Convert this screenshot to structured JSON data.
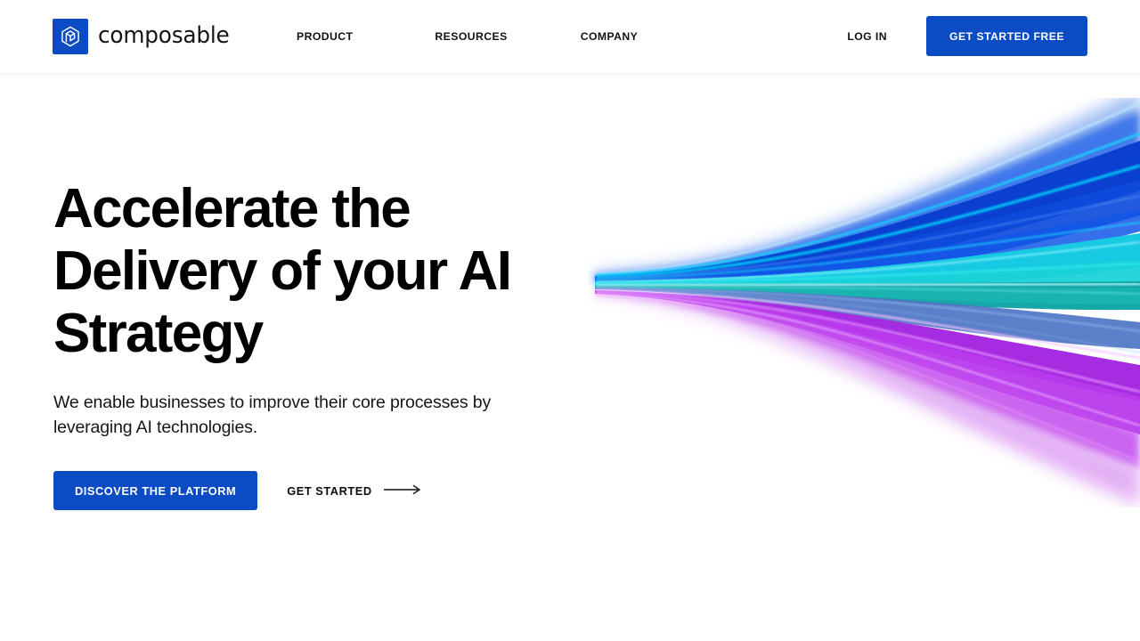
{
  "site": {
    "brand_name": "composable",
    "accent_color": "#0B4BC4",
    "text_color": "#000000",
    "background_color": "#FFFFFF"
  },
  "header": {
    "logo": {
      "icon": "hexagon-cube-icon",
      "wordmark": "composable"
    },
    "nav": [
      {
        "label": "PRODUCT"
      },
      {
        "label": "RESOURCES"
      },
      {
        "label": "COMPANY"
      }
    ],
    "login_label": "LOG IN",
    "cta_label": "GET STARTED FREE"
  },
  "hero": {
    "title_line_1": "Accelerate the",
    "title_line_2": "Delivery of your AI",
    "title_line_3": "Strategy",
    "title": "Accelerate the Delivery of your AI Strategy",
    "subtitle": "We enable businesses to improve their core processes by leveraging AI technologies.",
    "primary_cta_label": "DISCOVER THE PLATFORM",
    "secondary_cta_label": "GET STARTED",
    "secondary_cta_icon": "long-arrow-right-icon",
    "artwork": {
      "name": "abstract-light-streaks",
      "description": "Converging fan of curved light beams sweeping from a white focal point at the left and fanning out to the right edge",
      "colors": [
        "#1F5BE0",
        "#0A3FD0",
        "#14C8E8",
        "#1BD4D4",
        "#16A8A8",
        "#5E7BC8",
        "#B02CE0",
        "#D36BEA"
      ]
    }
  }
}
